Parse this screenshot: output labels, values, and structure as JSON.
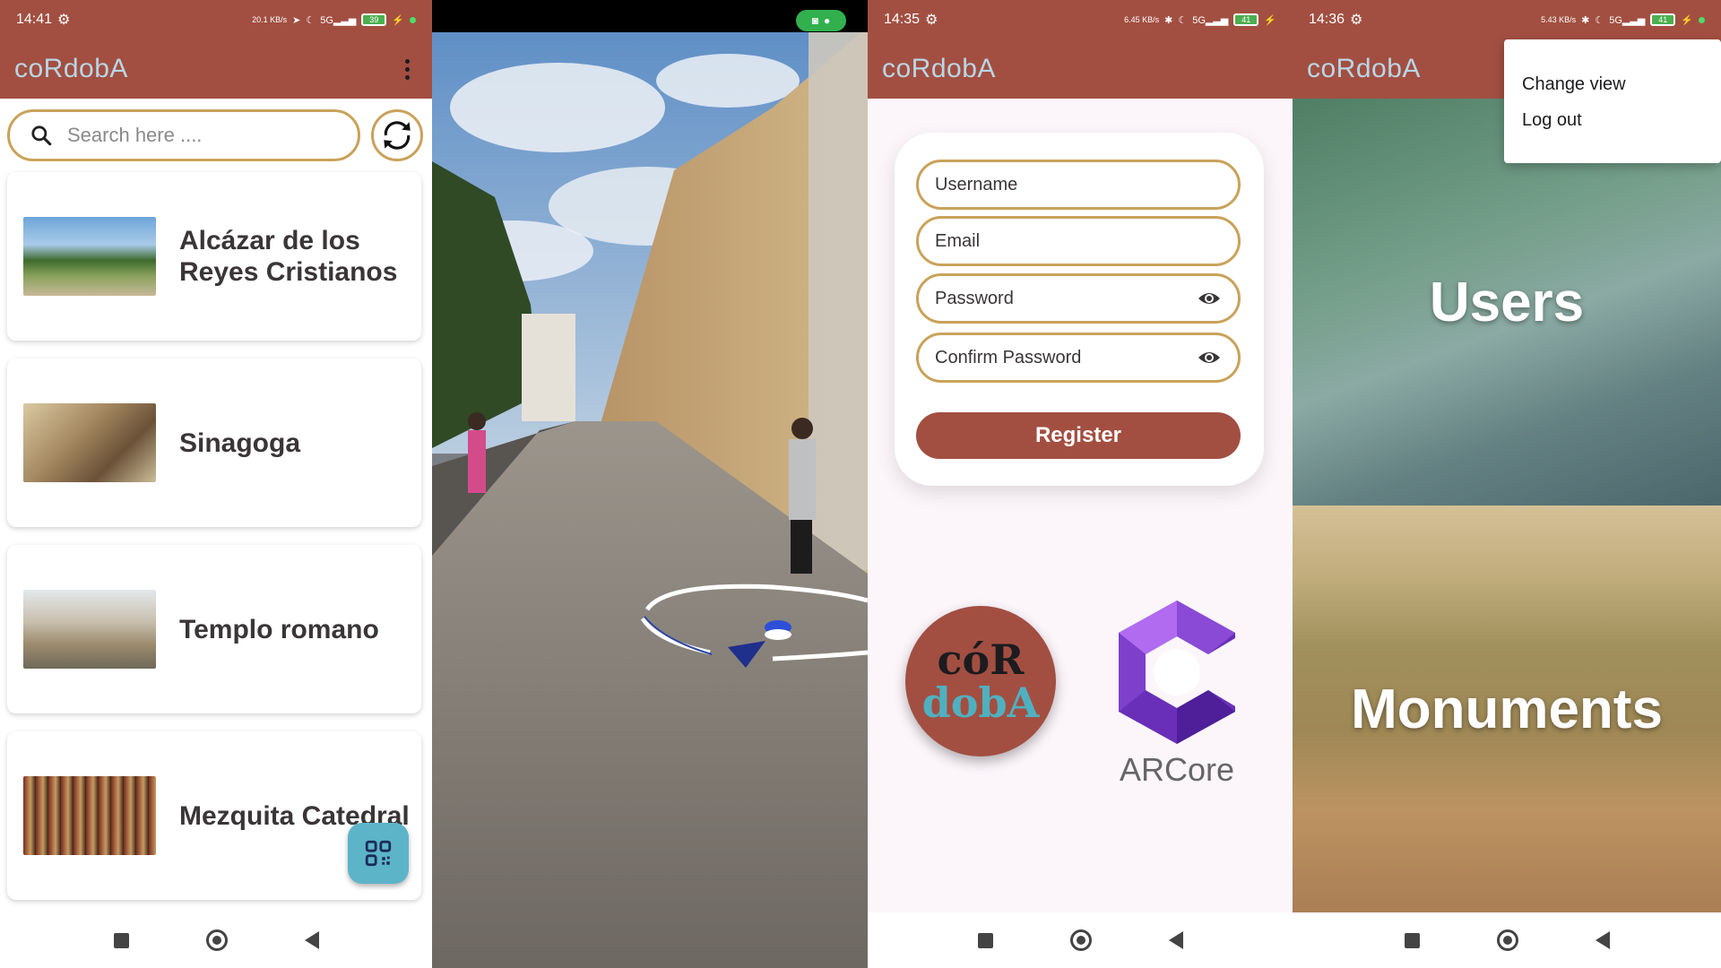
{
  "app": {
    "title": "coRdobA"
  },
  "p1": {
    "time": "14:41",
    "net_speed": "20.1 KB/s",
    "battery": "39",
    "search_placeholder": "Search here ....",
    "items": [
      {
        "title": "Alcázar de los Reyes Cristianos"
      },
      {
        "title": "Sinagoga"
      },
      {
        "title": "Templo romano"
      },
      {
        "title": "Mezquita Catedral"
      }
    ]
  },
  "p3": {
    "time": "14:35",
    "net_speed": "6.45 KB/s",
    "battery": "41",
    "fields": {
      "username": "Username",
      "email": "Email",
      "password": "Password",
      "confirm_password": "Confirm Password"
    },
    "register_label": "Register",
    "logo_text_top": "cóR",
    "logo_text_bottom": "dobA",
    "arcore_label": "ARCore"
  },
  "p4": {
    "time": "14:36",
    "net_speed": "5.43 KB/s",
    "battery": "41",
    "menu": [
      "Change view",
      "Log out"
    ],
    "tiles": {
      "users": "Users",
      "monuments": "Monuments"
    }
  },
  "colors": {
    "primary": "#a24f41",
    "accent": "#c9a25a",
    "title": "#b9d6e6",
    "fab": "#5cb4c8"
  }
}
